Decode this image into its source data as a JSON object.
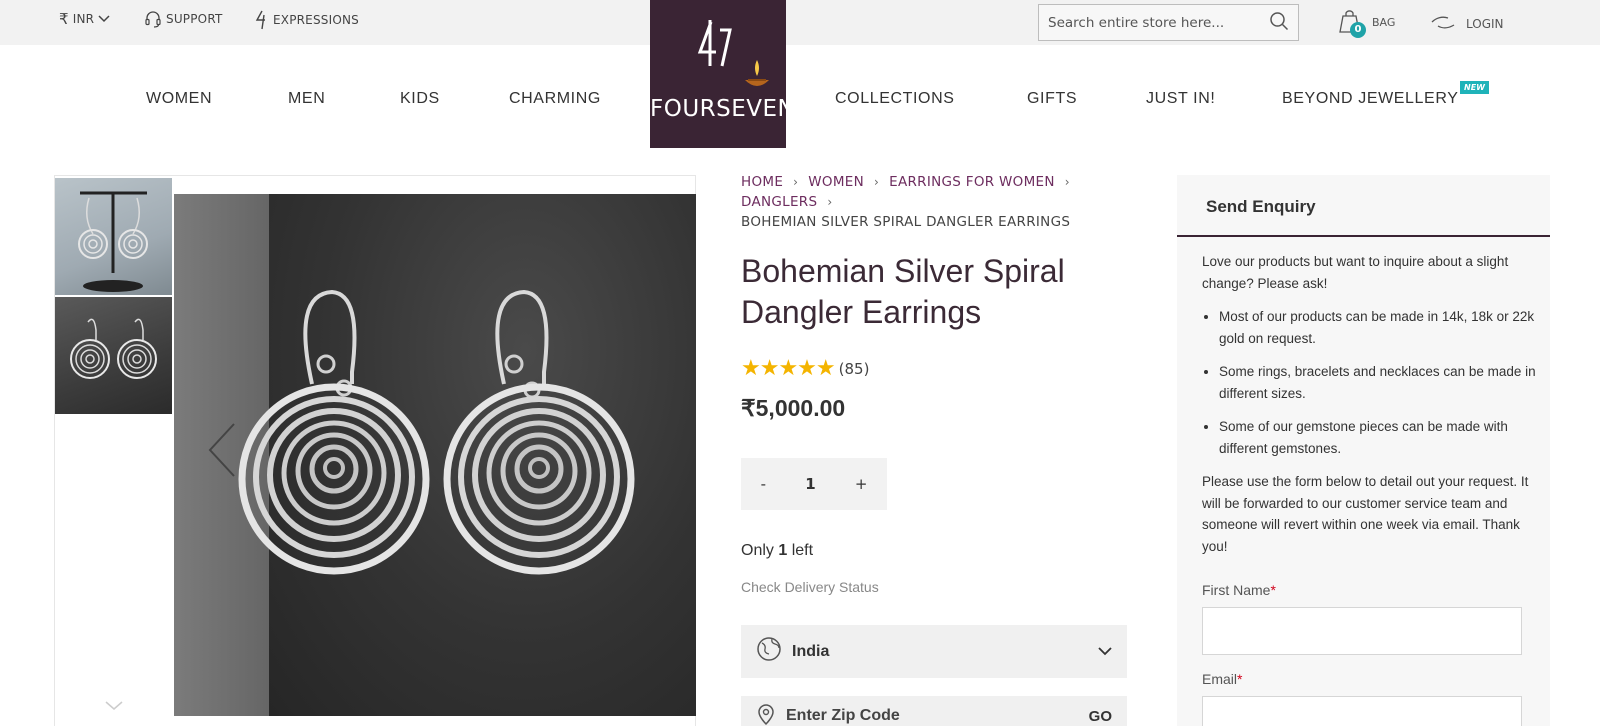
{
  "topbar": {
    "currency": "INR",
    "support": "SUPPORT",
    "expressions": "EXPRESSIONS",
    "search_placeholder": "Search entire store here...",
    "bag_count": "0",
    "bag_label": "BAG",
    "login_label": "LOGIN"
  },
  "logo": {
    "text": "FOURSEVEN"
  },
  "nav": {
    "women": "WOMEN",
    "men": "MEN",
    "kids": "KIDS",
    "charming": "CHARMING",
    "collections": "COLLECTIONS",
    "gifts": "GIFTS",
    "just_in": "JUST IN!",
    "beyond": "BEYOND JEWELLERY",
    "new_badge": "NEW"
  },
  "breadcrumb": {
    "home": "HOME",
    "women": "WOMEN",
    "earrings": "EARRINGS FOR WOMEN",
    "danglers": "DANGLERS",
    "current": "BOHEMIAN SILVER SPIRAL DANGLER EARRINGS"
  },
  "product": {
    "title": "Bohemian Silver Spiral Dangler Earrings",
    "stars": "★★★★★",
    "rating_count": "(85)",
    "price": "₹5,000.00",
    "qty_minus": "-",
    "qty_value": "1",
    "qty_plus": "+",
    "stock_prefix": "Only ",
    "stock_count": "1",
    "stock_suffix": " left",
    "delivery_label": "Check Delivery Status",
    "country": "India",
    "zip_placeholder": "Enter Zip Code",
    "zip_go": "GO"
  },
  "enquiry": {
    "title": "Send Enquiry",
    "intro": "Love our products but want to inquire about a slight change? Please ask!",
    "points": [
      "Most of our products can be made in 14k, 18k or 22k gold on request.",
      "Some rings, bracelets and necklaces can be made in different sizes.",
      "Some of our gemstone pieces can be made with different gemstones."
    ],
    "outro": "Please use the form below to detail out your request. It will be forwarded to our customer service team and someone will revert within one week via email. Thank you!",
    "first_name_label": "First Name",
    "email_label": "Email",
    "required_mark": "*"
  },
  "colors": {
    "brand": "#3a2434",
    "accent": "#1fa3a8",
    "star": "#f4b400",
    "breadcrumb": "#6d2d5f"
  }
}
